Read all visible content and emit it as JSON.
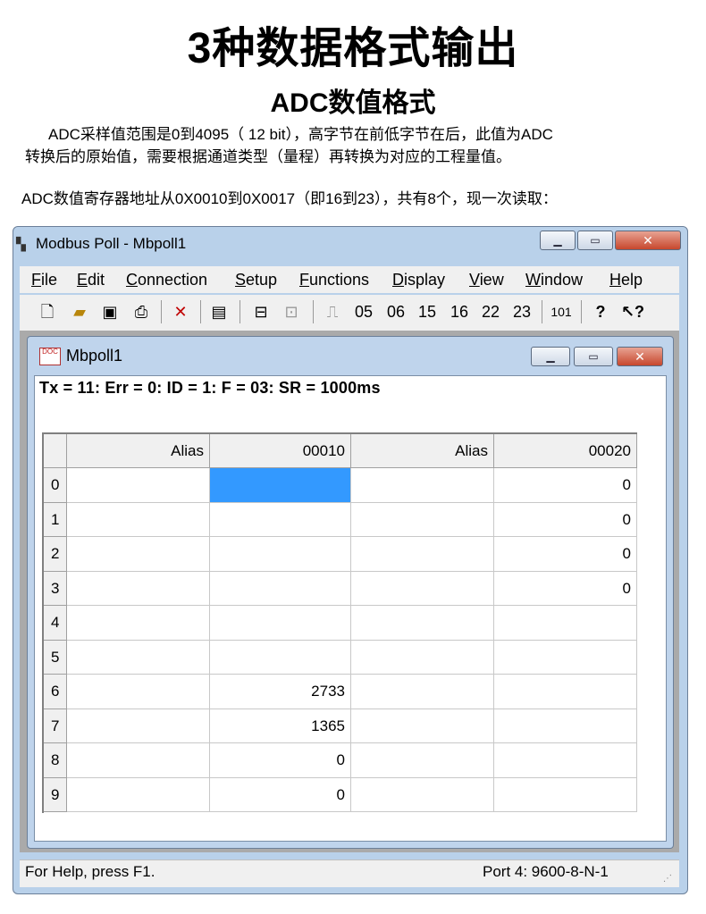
{
  "heading": {
    "title": "3种数据格式输出",
    "subtitle": "ADC数值格式"
  },
  "description": {
    "p1_line1": "ADC采样值范围是0到4095（ 12 bit），高字节在前低字节在后，此值为ADC",
    "p1_line2": "转换后的原始值，需要根据通道类型（量程）再转换为对应的工程量值。",
    "p2": "ADC数值寄存器地址从0X0010到0X0017（即16到23），共有8个，现一次读取："
  },
  "window": {
    "title": "Modbus Poll - Mbpoll1"
  },
  "menu": [
    "File",
    "Edit",
    "Connection",
    "Setup",
    "Functions",
    "Display",
    "View",
    "Window",
    "Help"
  ],
  "toolbar": {
    "fn_codes": [
      "05",
      "06",
      "15",
      "16",
      "22",
      "23"
    ],
    "address_label": "101"
  },
  "doc": {
    "title": "Mbpoll1",
    "status": "Tx = 11: Err = 0: ID = 1: F = 03: SR = 1000ms",
    "columns": [
      "Alias",
      "00010",
      "Alias",
      "00020"
    ],
    "rows": [
      {
        "index": "0",
        "alias1": "",
        "v1": "",
        "alias2": "",
        "v2": "0"
      },
      {
        "index": "1",
        "alias1": "",
        "v1": "",
        "alias2": "",
        "v2": "0"
      },
      {
        "index": "2",
        "alias1": "",
        "v1": "",
        "alias2": "",
        "v2": "0"
      },
      {
        "index": "3",
        "alias1": "",
        "v1": "",
        "alias2": "",
        "v2": "0"
      },
      {
        "index": "4",
        "alias1": "",
        "v1": "",
        "alias2": "",
        "v2": ""
      },
      {
        "index": "5",
        "alias1": "",
        "v1": "",
        "alias2": "",
        "v2": ""
      },
      {
        "index": "6",
        "alias1": "",
        "v1": "2733",
        "alias2": "",
        "v2": ""
      },
      {
        "index": "7",
        "alias1": "",
        "v1": "1365",
        "alias2": "",
        "v2": ""
      },
      {
        "index": "8",
        "alias1": "",
        "v1": "0",
        "alias2": "",
        "v2": ""
      },
      {
        "index": "9",
        "alias1": "",
        "v1": "0",
        "alias2": "",
        "v2": ""
      }
    ]
  },
  "statusbar": {
    "help": "For Help, press F1.",
    "port": "Port 4: 9600-8-N-1"
  },
  "colors": {
    "selection": "#3399ff",
    "window_frame": "#b9d1ea",
    "close_button": "#c7472d"
  }
}
